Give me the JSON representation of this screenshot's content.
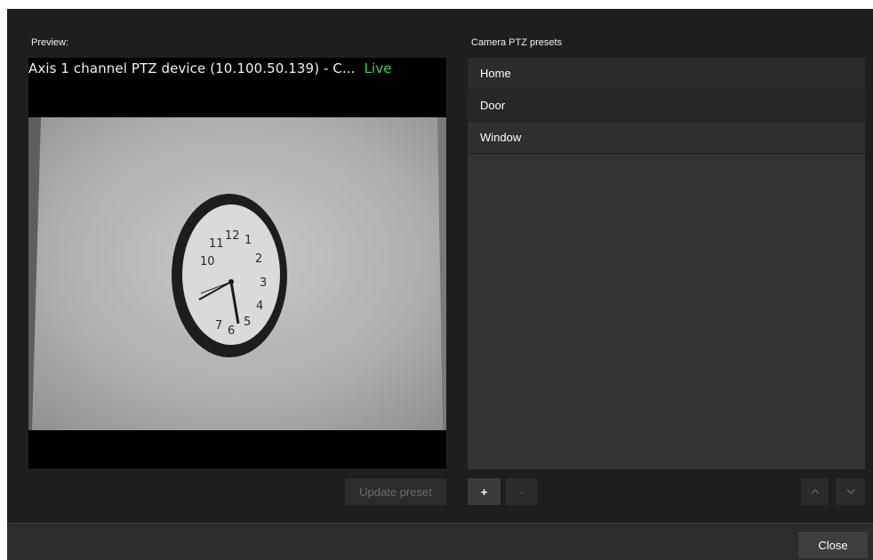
{
  "preview": {
    "label": "Preview:",
    "camera_title": "Axis 1 channel PTZ device (10.100.50.139) - C...",
    "live_status": "Live",
    "live_color": "#3fd23f"
  },
  "presets": {
    "label": "Camera PTZ presets",
    "items": [
      {
        "label": "Home"
      },
      {
        "label": "Door"
      },
      {
        "label": "Window"
      }
    ]
  },
  "buttons": {
    "update_preset": "Update preset",
    "add": "+",
    "remove": "-",
    "move_up_icon": "chevron-up-icon",
    "move_down_icon": "chevron-down-icon",
    "close": "Close"
  },
  "clock": {
    "numerals": [
      "12",
      "1",
      "2",
      "3",
      "4",
      "5",
      "6",
      "7",
      "10",
      "11"
    ]
  }
}
